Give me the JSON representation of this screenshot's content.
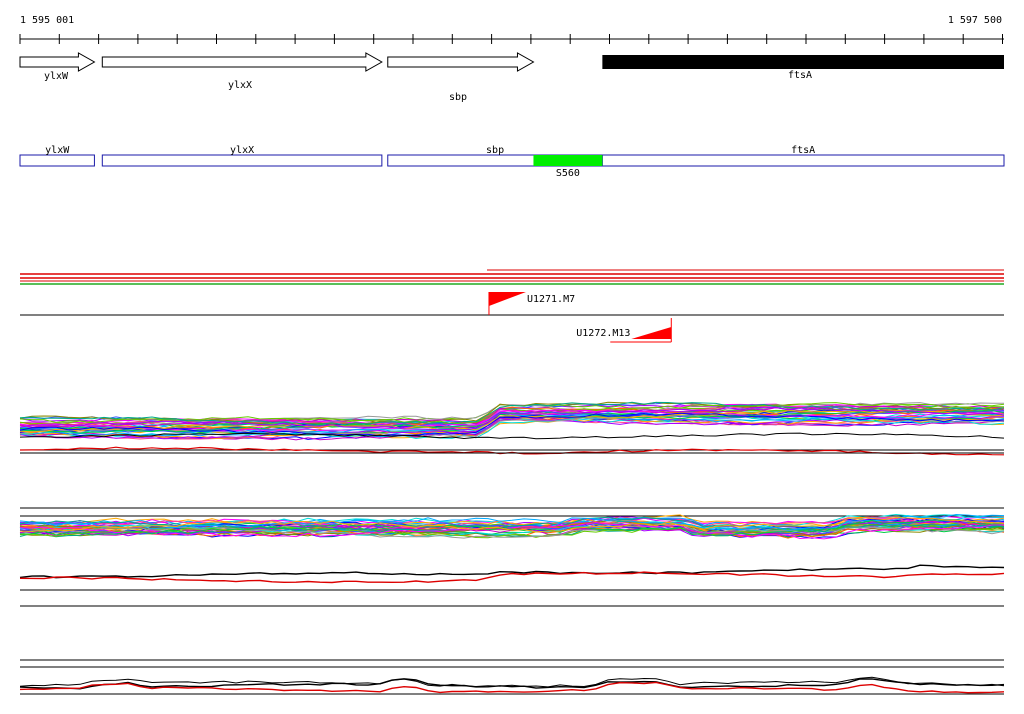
{
  "coordinates": {
    "start": "1 595 001",
    "end": "1 597 500"
  },
  "genes_track": [
    {
      "name": "ylxW",
      "start": 1595001,
      "end": 1595190,
      "strand": "+",
      "filled": false
    },
    {
      "name": "ylxX",
      "start": 1595210,
      "end": 1595920,
      "strand": "+",
      "filled": false
    },
    {
      "name": "sbp",
      "start": 1595935,
      "end": 1596305,
      "strand": "+",
      "filled": false
    },
    {
      "name": "ftsA",
      "start": 1596480,
      "end": 1597500,
      "strand": "+",
      "filled": true
    }
  ],
  "annotation_track": {
    "features": [
      {
        "name": "ylxW",
        "start": 1595001,
        "end": 1595190
      },
      {
        "name": "ylxX",
        "start": 1595210,
        "end": 1595920
      },
      {
        "name": "sbp",
        "start": 1595935,
        "end": 1596480
      },
      {
        "name": "ftsA",
        "start": 1596480,
        "end": 1597500
      }
    ],
    "highlight": {
      "name": "S560",
      "start": 1596305,
      "end": 1596480,
      "color": "#00ee00"
    }
  },
  "promoters": [
    {
      "name": "U1271.M7",
      "position": 1596192,
      "direction": "forward"
    },
    {
      "name": "U1272.M13",
      "position": 1596655,
      "direction": "reverse"
    }
  ],
  "colors": {
    "gene_filled": "#000000",
    "annotation_box": "#1a1aa8",
    "promoter": "#ff0000",
    "expression_main": "#000000",
    "expression_alt": "#dd0000"
  }
}
